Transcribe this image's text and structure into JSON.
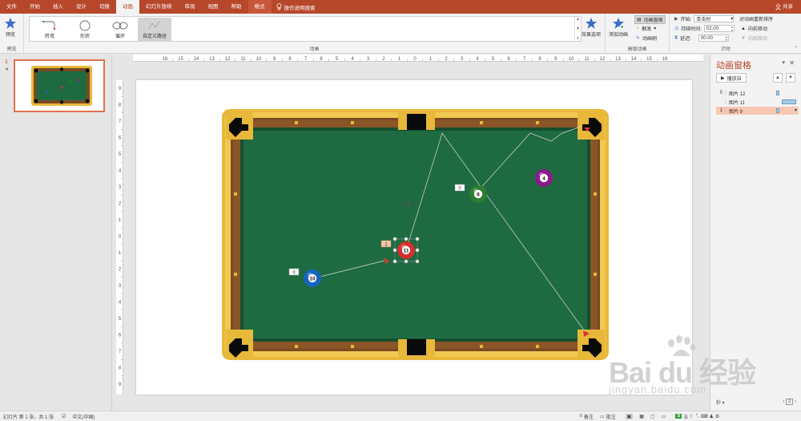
{
  "tabs": [
    "文件",
    "开始",
    "插入",
    "设计",
    "切换",
    "动画",
    "幻灯片放映",
    "审阅",
    "视图",
    "帮助",
    "格式"
  ],
  "active_tab": "动画",
  "tell_me": "操作说明搜索",
  "share": "共享",
  "ribbon": {
    "preview_label": "预览",
    "preview_group": "预览",
    "animation_group": "动画",
    "gallery": [
      "转弯",
      "形状",
      "循环",
      "自定义路径"
    ],
    "effect_options": "效果选项",
    "add_animation": "添加动画",
    "anim_pane_btn": "动画窗格",
    "trigger": "触发",
    "anim_painter": "动画刷",
    "advanced_group": "高级动画",
    "start_label": "开始:",
    "start_value": "单击时",
    "duration_label": "持续时间:",
    "duration_value": "02.00",
    "delay_label": "延迟:",
    "delay_value": "00.00",
    "reorder_title": "对动画重新排序",
    "move_earlier": "向前移动",
    "move_later": "向后移动",
    "timing_group": "计时"
  },
  "thumb": {
    "number": "1",
    "star": "★"
  },
  "hruler_labels": [
    "16",
    "15",
    "14",
    "13",
    "12",
    "11",
    "10",
    "9",
    "8",
    "7",
    "6",
    "5",
    "4",
    "3",
    "2",
    "1",
    "0",
    "1",
    "2",
    "3",
    "4",
    "5",
    "6",
    "7",
    "8",
    "9",
    "10",
    "11",
    "12",
    "13",
    "14",
    "15",
    "16"
  ],
  "vruler_labels": [
    "9",
    "8",
    "7",
    "6",
    "5",
    "4",
    "3",
    "2",
    "1",
    "0",
    "1",
    "2",
    "3",
    "4",
    "5",
    "6",
    "7",
    "8",
    "9"
  ],
  "slide": {
    "balls": [
      {
        "label": "4",
        "color": "#8b1a8b"
      },
      {
        "label": "6",
        "color": "#2e7d32"
      },
      {
        "label": "11",
        "color": "#d32f2f"
      },
      {
        "label": "10",
        "color": "#1565c0"
      }
    ],
    "tags": [
      "0",
      "1",
      "0"
    ],
    "colors": {
      "felt": "#1e6b41",
      "felt_edge": "#164f30",
      "wood": "#7a4a23",
      "gold": "#e7b83a",
      "pocket": "#0a0a0a"
    }
  },
  "anim_pane": {
    "title": "动画窗格",
    "play": "播放自",
    "items": [
      {
        "num": "0",
        "name": "图片 12"
      },
      {
        "num": "",
        "name": "图片 11"
      },
      {
        "num": "1",
        "name": "图片 9"
      }
    ],
    "footer_unit": "秒",
    "footer_page": "2"
  },
  "status": {
    "slide_info": "幻灯片 第 1 张，共 1 张",
    "language": "中文(中国)",
    "notes": "备注",
    "comments": "批注"
  },
  "watermark": {
    "main": "Bai du 经验",
    "sub": "jingyan.baidu.com"
  }
}
